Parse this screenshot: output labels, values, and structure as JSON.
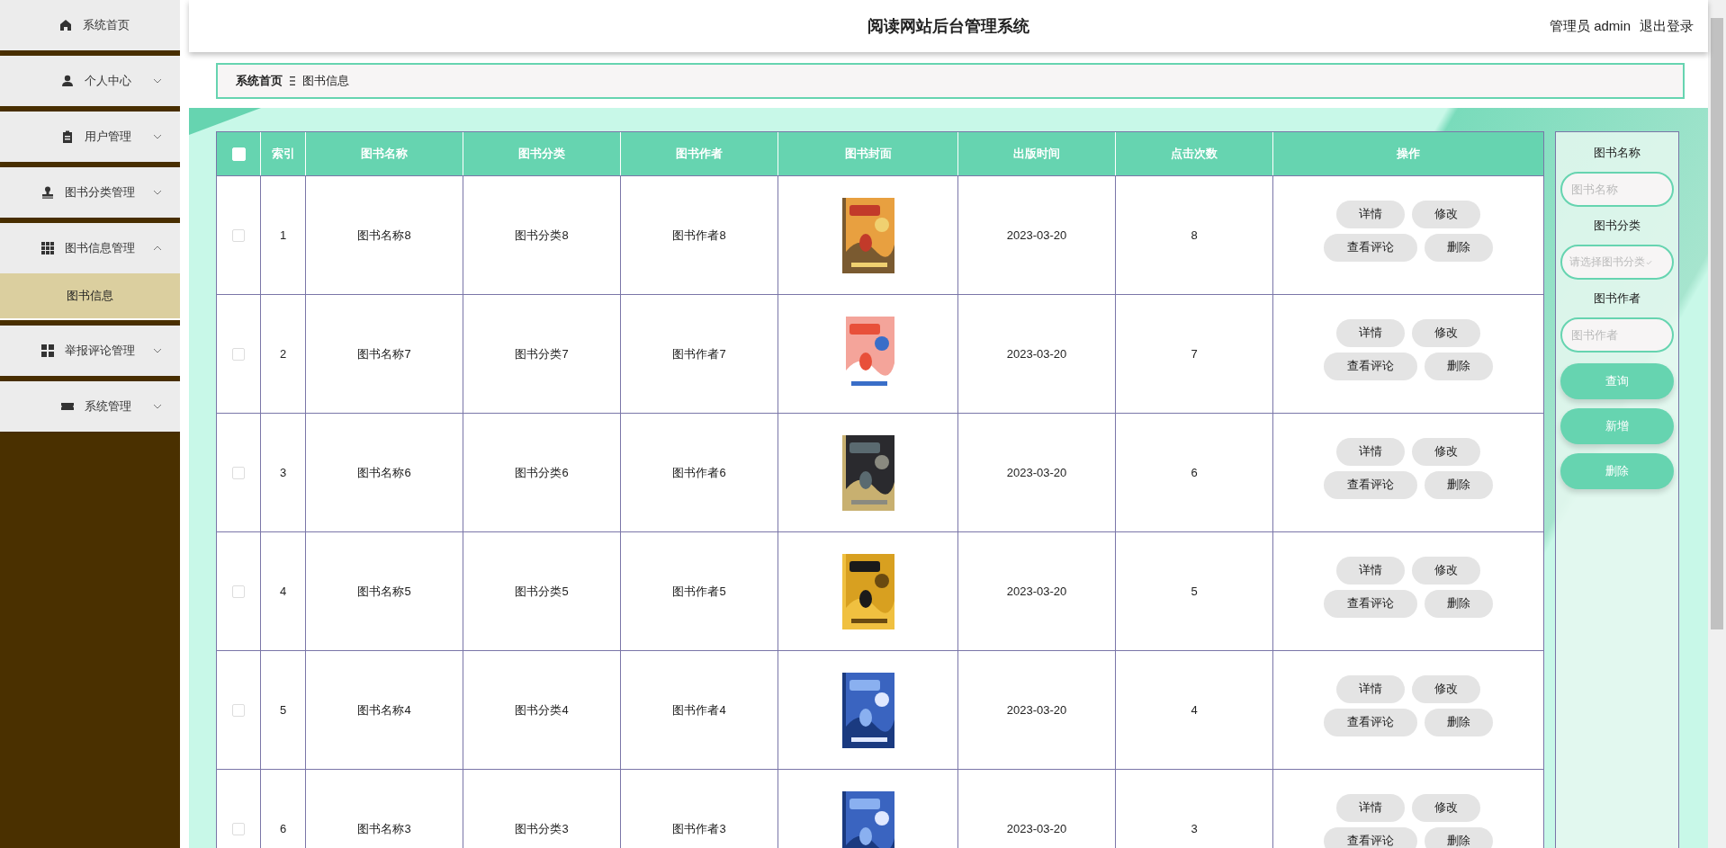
{
  "sidebar": {
    "items": [
      {
        "label": "系统首页",
        "kind": "link"
      },
      {
        "label": "个人中心",
        "kind": "group",
        "expanded": false
      },
      {
        "label": "用户管理",
        "kind": "group",
        "expanded": false
      },
      {
        "label": "图书分类管理",
        "kind": "group",
        "expanded": false
      },
      {
        "label": "图书信息管理",
        "kind": "group",
        "expanded": true,
        "children": [
          {
            "label": "图书信息",
            "selected": true
          }
        ]
      },
      {
        "label": "举报评论管理",
        "kind": "group",
        "expanded": false
      },
      {
        "label": "系统管理",
        "kind": "group",
        "expanded": false
      }
    ]
  },
  "header": {
    "title": "阅读网站后台管理系统",
    "user": "管理员 admin",
    "logout": "退出登录"
  },
  "breadcrumb": [
    "系统首页",
    "图书信息"
  ],
  "table": {
    "select_all": {
      "checked": false
    },
    "columns": [
      "索引",
      "图书名称",
      "图书分类",
      "图书作者",
      "图书封面",
      "出版时间",
      "点击次数",
      "操作"
    ],
    "rows": [
      {
        "checked": false,
        "index": "1",
        "name": "图书名称8",
        "category": "图书分类8",
        "author": "图书作者8",
        "date": "2023-03-20",
        "clicks": "8",
        "actions": [
          "详情",
          "修改",
          "查看评论",
          "删除"
        ]
      },
      {
        "checked": false,
        "index": "2",
        "name": "图书名称7",
        "category": "图书分类7",
        "author": "图书作者7",
        "date": "2023-03-20",
        "clicks": "7",
        "actions": [
          "详情",
          "修改",
          "查看评论",
          "删除"
        ]
      },
      {
        "checked": false,
        "index": "3",
        "name": "图书名称6",
        "category": "图书分类6",
        "author": "图书作者6",
        "date": "2023-03-20",
        "clicks": "6",
        "actions": [
          "详情",
          "修改",
          "查看评论",
          "删除"
        ]
      },
      {
        "checked": false,
        "index": "4",
        "name": "图书名称5",
        "category": "图书分类5",
        "author": "图书作者5",
        "date": "2023-03-20",
        "clicks": "5",
        "actions": [
          "详情",
          "修改",
          "查看评论",
          "删除"
        ]
      },
      {
        "checked": false,
        "index": "5",
        "name": "图书名称4",
        "category": "图书分类4",
        "author": "图书作者4",
        "date": "2023-03-20",
        "clicks": "4",
        "actions": [
          "详情",
          "修改",
          "查看评论",
          "删除"
        ]
      },
      {
        "checked": false,
        "index": "6",
        "name": "图书名称3",
        "category": "图书分类3",
        "author": "图书作者3",
        "date": "2023-03-20",
        "clicks": "3",
        "actions": [
          "详情",
          "修改",
          "查看评论",
          "删除"
        ]
      }
    ]
  },
  "search": {
    "fields": [
      {
        "label": "图书名称",
        "placeholder": "图书名称",
        "kind": "input"
      },
      {
        "label": "图书分类",
        "placeholder": "请选择图书分类",
        "kind": "select"
      },
      {
        "label": "图书作者",
        "placeholder": "图书作者",
        "kind": "input"
      }
    ],
    "buttons": [
      "查询",
      "新增",
      "删除"
    ]
  }
}
